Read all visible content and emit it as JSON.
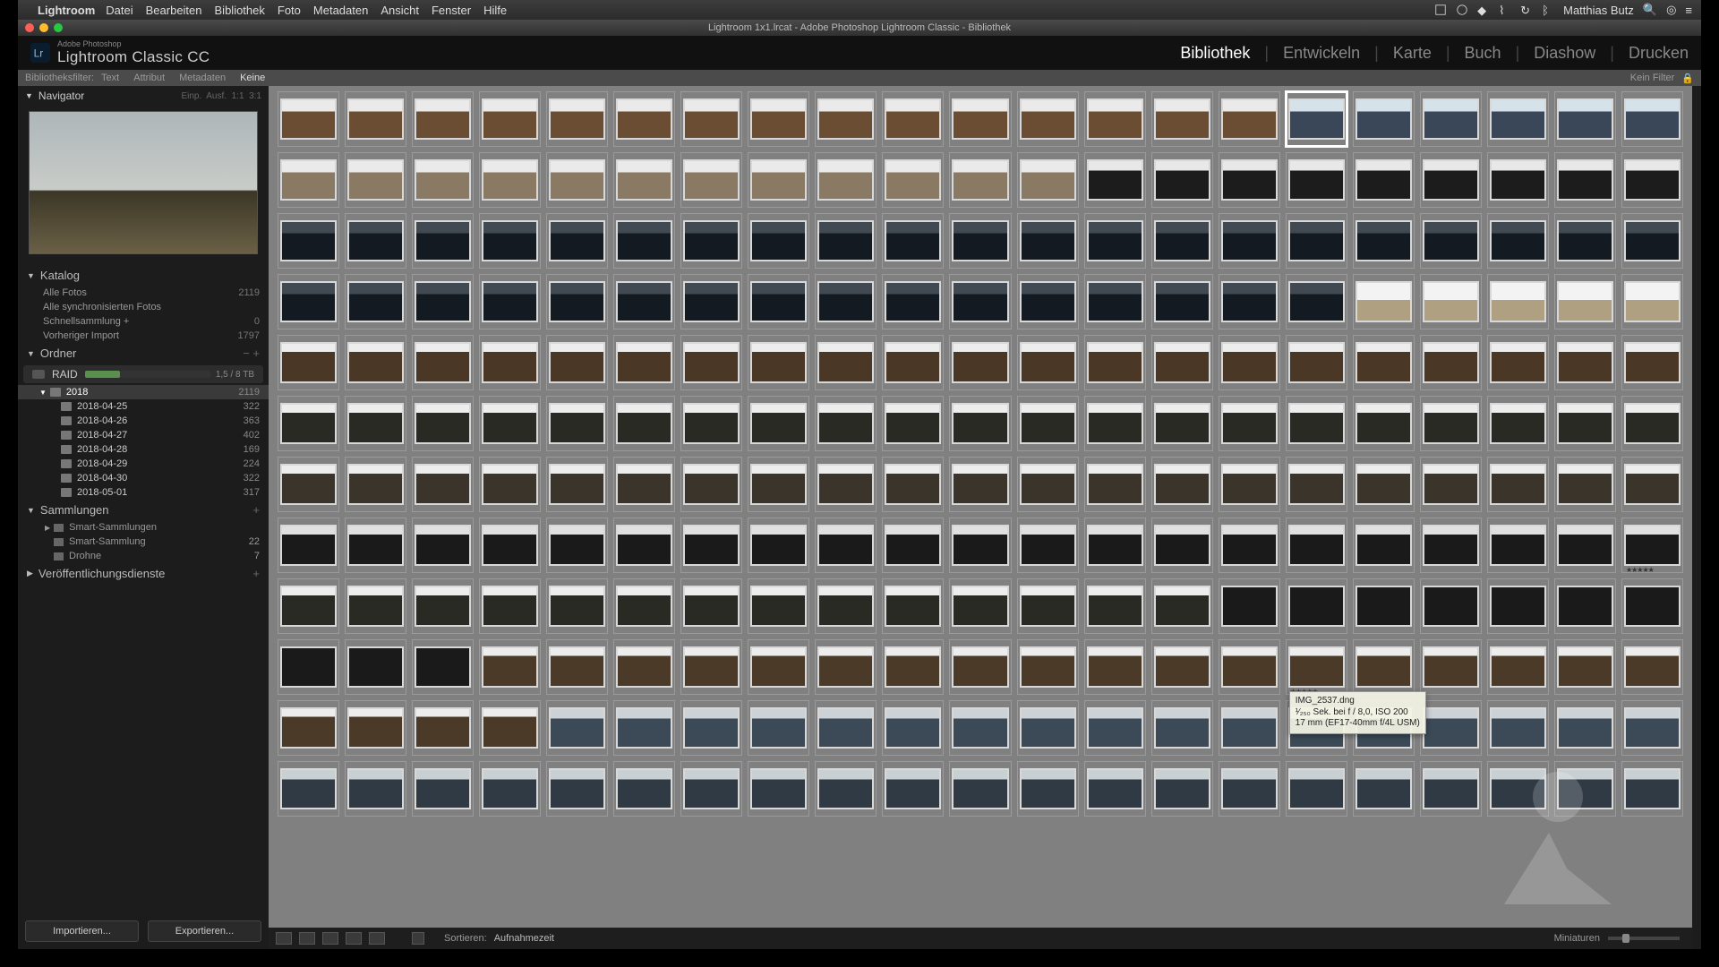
{
  "menubar": {
    "app": "Lightroom",
    "items": [
      "Datei",
      "Bearbeiten",
      "Bibliothek",
      "Foto",
      "Metadaten",
      "Ansicht",
      "Fenster",
      "Hilfe"
    ],
    "user": "Matthias Butz"
  },
  "window": {
    "title": "Lightroom 1x1.lrcat - Adobe Photoshop Lightroom Classic - Bibliothek"
  },
  "ident": {
    "sub": "Adobe Photoshop",
    "main": "Lightroom Classic CC"
  },
  "modules": [
    "Bibliothek",
    "Entwickeln",
    "Karte",
    "Buch",
    "Diashow",
    "Drucken"
  ],
  "active_module": "Bibliothek",
  "filterbar": {
    "label": "Bibliotheksfilter:",
    "text": "Text",
    "attribut": "Attribut",
    "metadaten": "Metadaten",
    "keine": "Keine",
    "filter_aus": "Kein Filter"
  },
  "nav": {
    "title": "Navigator",
    "fit": "Einp.",
    "fill": "Ausf.",
    "r1": "1:1",
    "r2": "3:1"
  },
  "katalog": {
    "title": "Katalog",
    "rows": [
      {
        "label": "Alle Fotos",
        "value": "2119"
      },
      {
        "label": "Alle synchronisierten Fotos",
        "value": ""
      },
      {
        "label": "Schnellsammlung  +",
        "value": "0"
      },
      {
        "label": "Vorheriger Import",
        "value": "1797"
      }
    ]
  },
  "ordner": {
    "title": "Ordner",
    "volume": {
      "name": "RAID",
      "free": "1,5 / 8 TB"
    },
    "year": {
      "name": "2018",
      "count": "2119"
    },
    "dates": [
      {
        "name": "2018-04-25",
        "count": "322"
      },
      {
        "name": "2018-04-26",
        "count": "363"
      },
      {
        "name": "2018-04-27",
        "count": "402"
      },
      {
        "name": "2018-04-28",
        "count": "169"
      },
      {
        "name": "2018-04-29",
        "count": "224"
      },
      {
        "name": "2018-04-30",
        "count": "322"
      },
      {
        "name": "2018-05-01",
        "count": "317"
      }
    ]
  },
  "sammlungen": {
    "title": "Sammlungen",
    "items": [
      {
        "name": "Smart-Sammlungen",
        "count": ""
      },
      {
        "name": "Smart-Sammlung",
        "count": "22"
      },
      {
        "name": "Drohne",
        "count": "7"
      }
    ]
  },
  "publish": {
    "title": "Veröffentlichungsdienste"
  },
  "import": {
    "import": "Importieren...",
    "export": "Exportieren..."
  },
  "toolbar": {
    "sort_label": "Sortieren:",
    "sort_value": "Aufnahmezeit",
    "miniaturen": "Miniaturen"
  },
  "tooltip": {
    "filename": "IMG_2537.dng",
    "line2": "¹⁄₂₅₀ Sek. bei f / 8,0, ISO 200",
    "line3": "17 mm (EF17-40mm f/4L USM)"
  },
  "grid": {
    "rows": [
      {
        "palette": "t-brown",
        "count": 15,
        "then": {
          "palette": "t-bluemt",
          "count": 6
        }
      },
      {
        "palette": "t-grey",
        "count": 12,
        "then": {
          "palette": "t-person",
          "count": 9
        }
      },
      {
        "palette": "t-dark",
        "count": 21
      },
      {
        "palette": "t-dark",
        "count": 16,
        "then": {
          "palette": "t-over",
          "count": 5
        }
      },
      {
        "palette": "t-rock",
        "count": 21
      },
      {
        "palette": "t-hiker",
        "count": 9,
        "then": {
          "palette": "t-stream",
          "count": 12
        }
      },
      {
        "palette": "t-valley",
        "count": 21
      },
      {
        "palette": "t-bw",
        "count": 21
      },
      {
        "palette": "t-water",
        "count": 14,
        "then": {
          "palette": "t-dshade",
          "count": 7
        }
      },
      {
        "palette": "t-dshade",
        "count": 3,
        "then": {
          "palette": "t-mvalley",
          "count": 18
        }
      },
      {
        "palette": "t-mvalley",
        "count": 4,
        "then": {
          "palette": "t-bluesea",
          "count": 17
        }
      },
      {
        "palette": "t-mtlake",
        "count": 21
      }
    ],
    "selected": {
      "row": 0,
      "col": 15
    },
    "starred": {
      "row": 7,
      "col": 20
    },
    "tooltip_at": {
      "row": 9,
      "col": 15
    }
  }
}
